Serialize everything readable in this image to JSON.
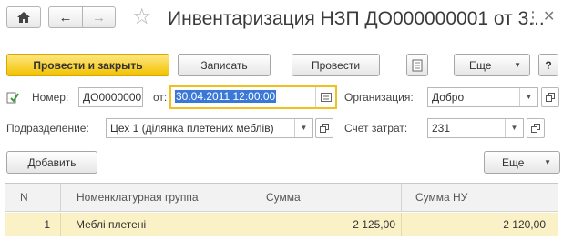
{
  "window": {
    "title": "Инвентаризация НЗП ДО000000001 от 3..."
  },
  "toolbar": {
    "post_close_label": "Провести и закрыть",
    "save_label": "Записать",
    "post_label": "Провести",
    "more_label": "Еще",
    "help_label": "?"
  },
  "form": {
    "number_label": "Номер:",
    "number_value": "ДО0000000",
    "date_label": "от:",
    "date_value": "30.04.2011 12:00:00",
    "org_label": "Организация:",
    "org_value": "Добро",
    "division_label": "Подразделение:",
    "division_value": "Цех 1 (ділянка плетених меблів)",
    "cost_label": "Счет затрат:",
    "cost_value": "231"
  },
  "table_toolbar": {
    "add_label": "Добавить",
    "more_label": "Еще"
  },
  "table": {
    "columns": [
      "N",
      "Номенклатурная группа",
      "Сумма",
      "Сумма НУ"
    ],
    "rows": [
      [
        "1",
        "Меблі плетені",
        "2 125,00",
        "2 120,00"
      ]
    ]
  },
  "colors": {
    "primary_button": "#f2c200",
    "selected_row": "#fbf1c6",
    "focus_border": "#f0c020",
    "selection": "#3a78d8"
  }
}
